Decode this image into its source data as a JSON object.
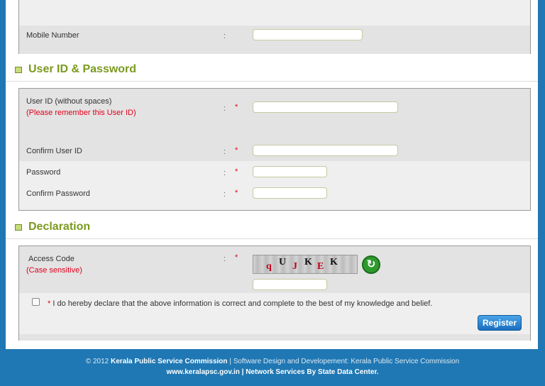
{
  "contact": {
    "mobile_label": "Mobile Number",
    "separator": ":"
  },
  "user_section": {
    "title": "User ID & Password",
    "user_id_label": "User ID (without spaces)",
    "user_id_note": "(Please remember this User ID)",
    "confirm_user_id_label": "Confirm User ID",
    "password_label": "Password",
    "confirm_password_label": "Confirm Password",
    "required_mark": "*"
  },
  "declaration_section": {
    "title": "Declaration",
    "access_code_label": "Access Code",
    "access_code_note": "(Case sensitive)",
    "captcha_chars": [
      "q",
      "U",
      "J",
      "K",
      "E",
      "K"
    ],
    "declaration_text": "I do hereby declare that the above information is correct and complete to the best of my knowledge and belief.",
    "register_label": "Register"
  },
  "footer": {
    "copyright": "© 2012",
    "org_name": "Kerala Public Service Commission",
    "design_credit": "| Software Design and Developement: Kerala Public Service Commission",
    "website": "www.keralapsc.gov.in",
    "network_credit": "| Network Services By State Data Center."
  },
  "colors": {
    "background_blue": "#1f78b4",
    "section_title_green": "#7a9a1e",
    "required_red": "#e0001b",
    "button_blue": "#1a6fbf"
  },
  "icons": {
    "section_marker": "section-square-icon",
    "captcha_refresh": "refresh-icon"
  }
}
